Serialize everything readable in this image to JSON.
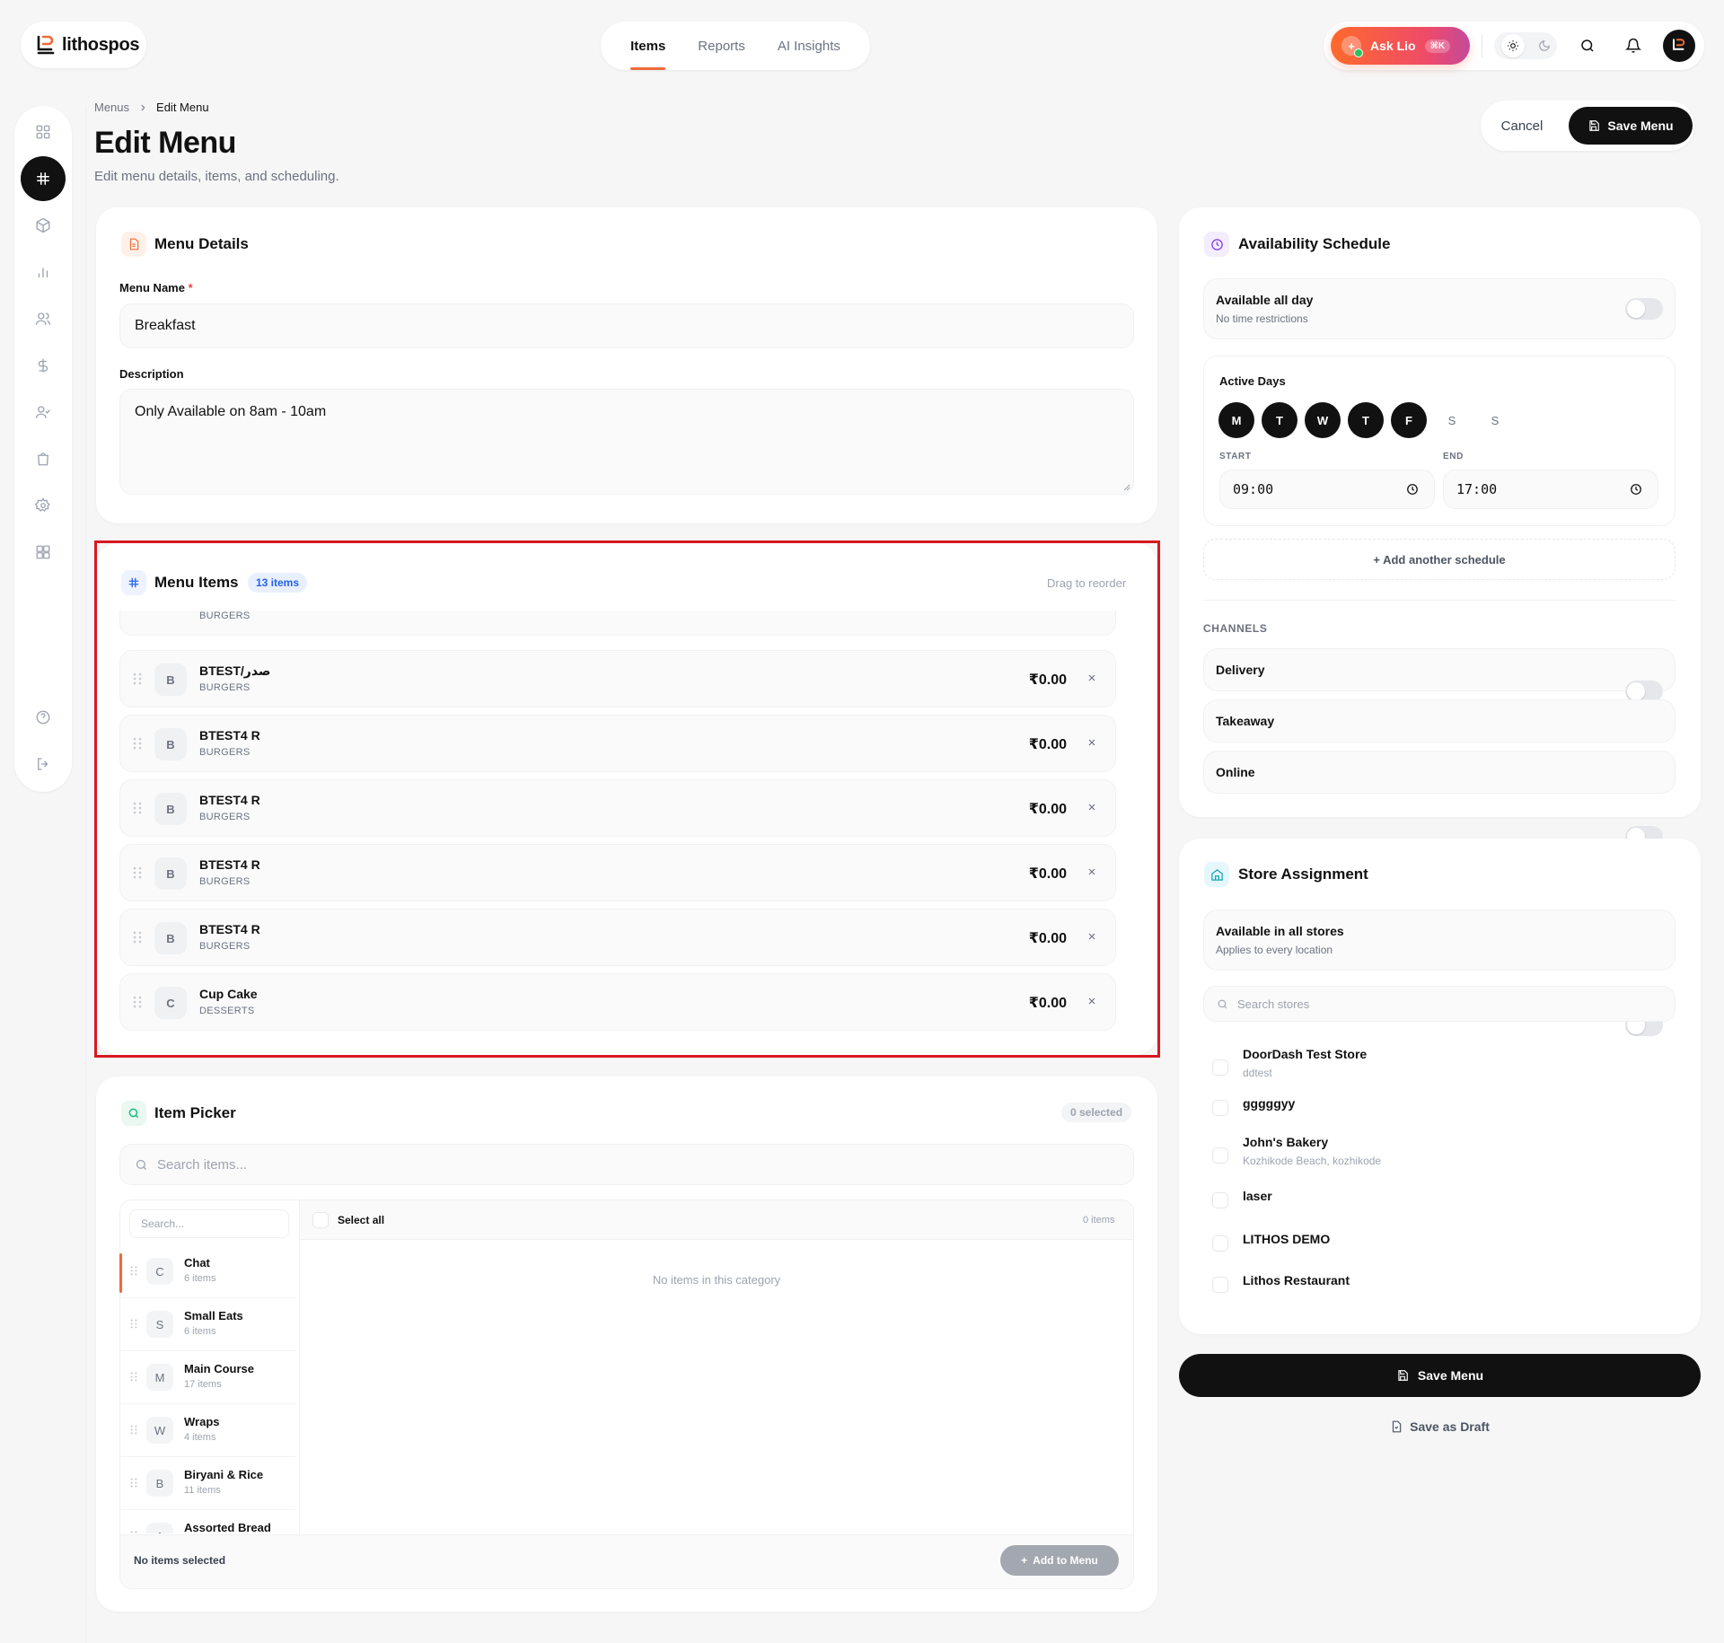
{
  "app": {
    "logo_text": "lithospos"
  },
  "nav": {
    "tabs": [
      "Items",
      "Reports",
      "AI Insights"
    ],
    "active": "Items"
  },
  "topbar": {
    "ask_label": "Ask Lio",
    "ask_shortcut": "⌘K"
  },
  "breadcrumb": {
    "parent": "Menus",
    "current": "Edit Menu"
  },
  "page": {
    "title": "Edit Menu",
    "subtitle": "Edit menu details, items, and scheduling."
  },
  "header_actions": {
    "cancel": "Cancel",
    "save": "Save Menu"
  },
  "menu_details": {
    "title": "Menu Details",
    "name_label": "Menu Name",
    "required_mark": "*",
    "name_value": "Breakfast",
    "description_label": "Description",
    "description_value": "Only Available on 8am - 10am"
  },
  "menu_items": {
    "title": "Menu Items",
    "count_badge": "13 items",
    "hint": "Drag to reorder",
    "partial_row": {
      "category": "BURGERS"
    },
    "rows": [
      {
        "letter": "B",
        "name": "BTEST/صدر",
        "category": "BURGERS",
        "price": "₹0.00"
      },
      {
        "letter": "B",
        "name": "BTEST4 R",
        "category": "BURGERS",
        "price": "₹0.00"
      },
      {
        "letter": "B",
        "name": "BTEST4 R",
        "category": "BURGERS",
        "price": "₹0.00"
      },
      {
        "letter": "B",
        "name": "BTEST4 R",
        "category": "BURGERS",
        "price": "₹0.00"
      },
      {
        "letter": "B",
        "name": "BTEST4 R",
        "category": "BURGERS",
        "price": "₹0.00"
      },
      {
        "letter": "C",
        "name": "Cup Cake",
        "category": "DESSERTS",
        "price": "₹0.00"
      }
    ]
  },
  "item_picker": {
    "title": "Item Picker",
    "selected_badge": "0 selected",
    "search_placeholder": "Search items...",
    "category_search_placeholder": "Search...",
    "select_all": "Select all",
    "items_count": "0 items",
    "empty_text": "No items in this category",
    "footer_status": "No items selected",
    "add_button": "Add to Menu",
    "categories": [
      {
        "letter": "C",
        "name": "Chat",
        "count": "6 items"
      },
      {
        "letter": "S",
        "name": "Small Eats",
        "count": "6 items"
      },
      {
        "letter": "M",
        "name": "Main Course",
        "count": "17 items"
      },
      {
        "letter": "W",
        "name": "Wraps",
        "count": "4 items"
      },
      {
        "letter": "B",
        "name": "Biryani & Rice",
        "count": "11 items"
      },
      {
        "letter": "A",
        "name": "Assorted Bread",
        "count": ""
      }
    ]
  },
  "availability": {
    "title": "Availability Schedule",
    "all_day_label": "Available all day",
    "all_day_sub": "No time restrictions",
    "active_days_label": "Active Days",
    "days": [
      {
        "label": "M",
        "active": true
      },
      {
        "label": "T",
        "active": true
      },
      {
        "label": "W",
        "active": true
      },
      {
        "label": "T",
        "active": true
      },
      {
        "label": "F",
        "active": true
      },
      {
        "label": "S",
        "active": false
      },
      {
        "label": "S",
        "active": false
      }
    ],
    "start_label": "START",
    "start_value": "09:00",
    "end_label": "END",
    "end_value": "17:00",
    "add_schedule": "+ Add another schedule",
    "channels_label": "CHANNELS",
    "channels": [
      "Delivery",
      "Takeaway",
      "Online"
    ]
  },
  "store_assignment": {
    "title": "Store Assignment",
    "all_stores_label": "Available in all stores",
    "all_stores_sub": "Applies to every location",
    "search_placeholder": "Search stores",
    "stores": [
      {
        "name": "DoorDash Test Store",
        "sub": "ddtest"
      },
      {
        "name": "gggggyy",
        "sub": ""
      },
      {
        "name": "John's Bakery",
        "sub": "Kozhikode Beach, kozhikode"
      },
      {
        "name": "laser",
        "sub": ""
      },
      {
        "name": "LITHOS DEMO",
        "sub": ""
      },
      {
        "name": "Lithos Restaurant",
        "sub": ""
      }
    ]
  },
  "footer_actions": {
    "save": "Save Menu",
    "draft": "Save as Draft"
  },
  "colors": {
    "accent": "#f06a3a",
    "primary": "#111111",
    "highlight_border": "#d71920",
    "badge_blue": "#2563eb"
  }
}
